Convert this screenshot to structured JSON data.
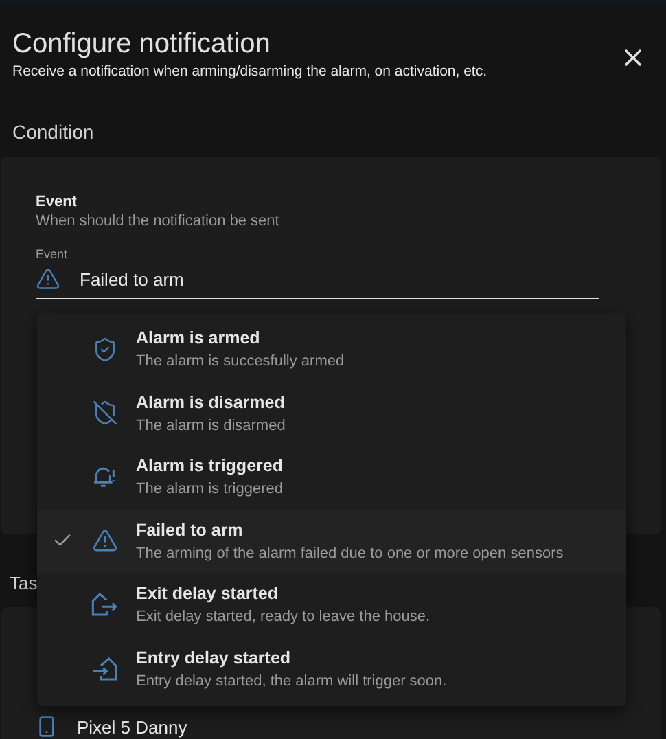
{
  "dialog": {
    "title": "Configure notification",
    "subtitle": "Receive a notification when arming/disarming the alarm, on activation, etc."
  },
  "condition": {
    "heading": "Condition",
    "event_title": "Event",
    "event_description": "When should the notification be sent",
    "field_label": "Event",
    "field_value": "Failed to arm"
  },
  "menu": {
    "items": [
      {
        "kind": "armed",
        "title": "Alarm is armed",
        "description": "The alarm is succesfully armed",
        "selected": false
      },
      {
        "kind": "disarmed",
        "title": "Alarm is disarmed",
        "description": "The alarm is disarmed",
        "selected": false
      },
      {
        "kind": "triggered",
        "title": "Alarm is triggered",
        "description": "The alarm is triggered",
        "selected": false
      },
      {
        "kind": "failed",
        "title": "Failed to arm",
        "description": "The arming of the alarm failed due to one or more open sensors",
        "selected": true
      },
      {
        "kind": "exit",
        "title": "Exit delay started",
        "description": "Exit delay started, ready to leave the house.",
        "selected": false
      },
      {
        "kind": "entry",
        "title": "Entry delay started",
        "description": "Entry delay started, the alarm will trigger soon.",
        "selected": false
      }
    ]
  },
  "task": {
    "heading": "Tas",
    "device": "Pixel 5 Danny"
  }
}
